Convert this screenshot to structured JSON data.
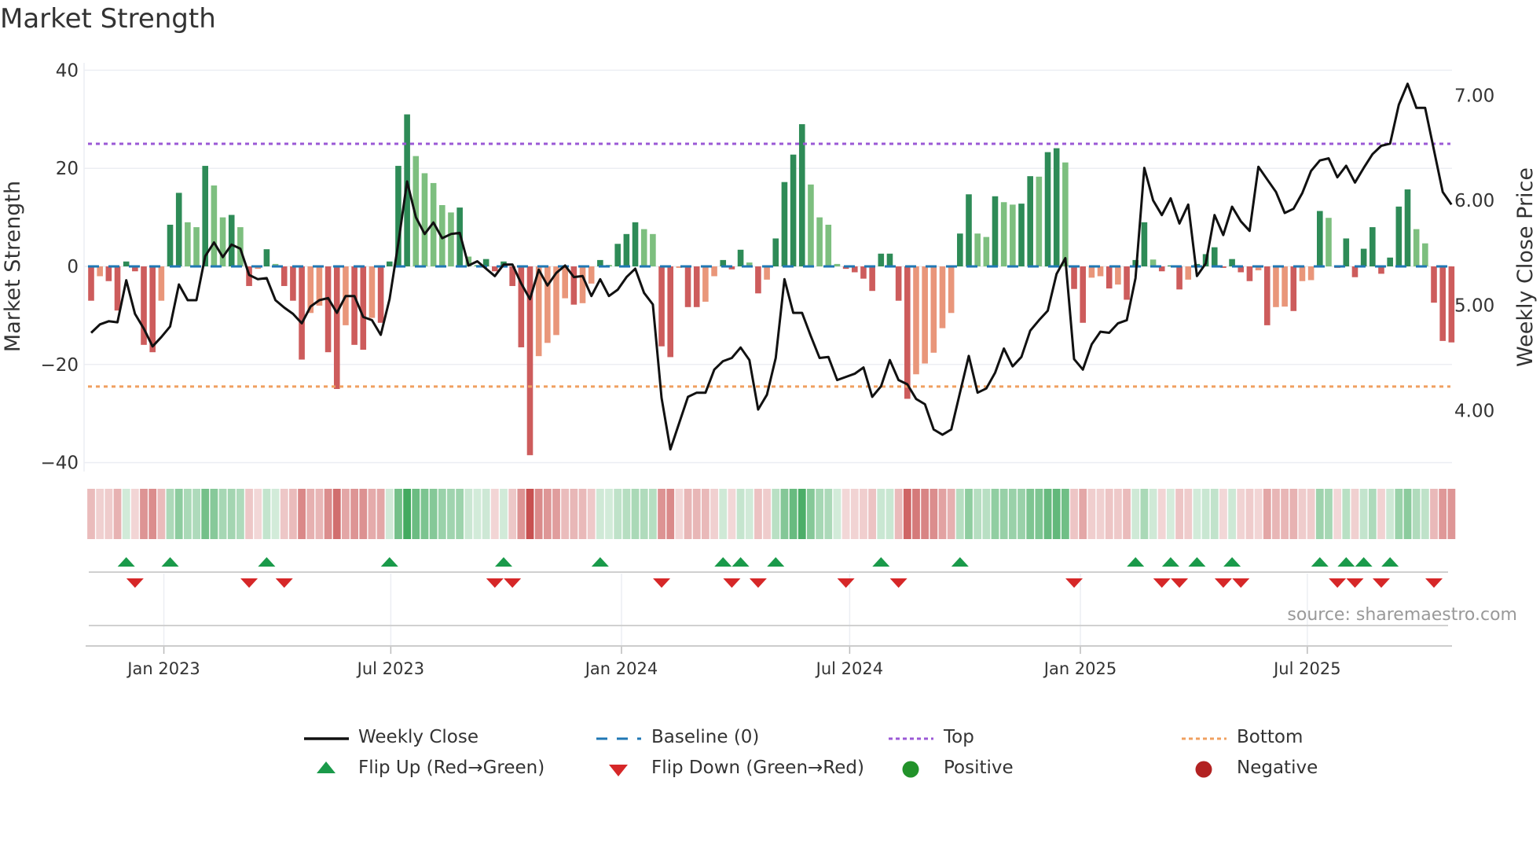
{
  "title": "Market Strength",
  "source": "source: sharemaestro.com",
  "chart_data": {
    "type": "bar",
    "title": "Market Strength",
    "ylabel": "Market Strength",
    "y2label": "Weekly Close Price",
    "ylim": [
      -40,
      40
    ],
    "y2lim": [
      3.5,
      7.3
    ],
    "yticks": [
      "40",
      "20",
      "0",
      "−20",
      "−40"
    ],
    "ytick_values": [
      40,
      20,
      0,
      -20,
      -40
    ],
    "y2ticks": [
      "7.00",
      "6.00",
      "5.00",
      "4.00"
    ],
    "y2tick_values": [
      7,
      6,
      5,
      4
    ],
    "frequency": "weekly",
    "first_week": "2022-11-04",
    "xticks": [
      {
        "label": "Jan 2023",
        "date": "2023-01-01"
      },
      {
        "label": "Jul 2023",
        "date": "2023-07-01"
      },
      {
        "label": "Jan 2024",
        "date": "2024-01-01"
      },
      {
        "label": "Jul 2024",
        "date": "2024-07-01"
      },
      {
        "label": "Jan 2025",
        "date": "2025-01-01"
      },
      {
        "label": "Jul 2025",
        "date": "2025-07-01"
      }
    ],
    "top_level": 25,
    "bottom_level": -24.5,
    "baseline": 0,
    "strength": [
      -7,
      -2,
      -3,
      -9,
      1,
      -1,
      -16,
      -17.5,
      -7,
      8.5,
      15,
      9,
      8,
      20.5,
      16.5,
      10,
      10.5,
      8,
      -4,
      -0.5,
      3.5,
      0.5,
      -4,
      -7,
      -19,
      -9.5,
      -8,
      -17.5,
      -25,
      -12,
      -16,
      -17,
      -10.5,
      -11.5,
      1,
      20.5,
      31,
      22.5,
      19,
      17,
      12.5,
      11,
      12,
      2,
      0.3,
      1.5,
      -1,
      1,
      -4,
      -16.5,
      -38.5,
      -18.3,
      -15.6,
      -14,
      -6.5,
      -7.8,
      -7.5,
      -3.5,
      1.3,
      0.3,
      4.6,
      6.6,
      9,
      7.6,
      6.6,
      -16.3,
      -18.5,
      -0.3,
      -8.3,
      -8.3,
      -7.2,
      -2,
      1.3,
      -0.6,
      3.4,
      0.8,
      -5.5,
      -2.7,
      5.7,
      17.2,
      22.8,
      29,
      16.7,
      10,
      8.5,
      0.5,
      -0.5,
      -1.2,
      -2.5,
      -5,
      2.6,
      2.6,
      -7,
      -27,
      -22,
      -19.8,
      -17.6,
      -12.6,
      -9.5,
      6.7,
      14.7,
      6.7,
      6,
      14.3,
      13.1,
      12.6,
      12.8,
      18.4,
      18.3,
      23.3,
      24.1,
      21.2,
      -4.6,
      -11.5,
      -2.3,
      -2,
      -4.5,
      -3.7,
      -6.8,
      1.3,
      9,
      1.4,
      -1,
      0.2,
      -4.7,
      -2.7,
      0.5,
      2.5,
      3.9,
      -0.3,
      1.5,
      -1.2,
      -3,
      -0.8,
      -12,
      -8.3,
      -8.2,
      -9.1,
      -3,
      -2.8,
      11.3,
      9.9,
      -0.3,
      5.7,
      -2.2,
      3.6,
      8,
      -1.5,
      1.8,
      12.2,
      15.7,
      7.6,
      4.7,
      -7.4,
      -15.2,
      -15.5
    ],
    "weekly_close": [
      4.74,
      4.82,
      4.85,
      4.84,
      5.24,
      4.92,
      4.78,
      4.61,
      4.7,
      4.8,
      5.2,
      5.05,
      5.05,
      5.47,
      5.6,
      5.46,
      5.58,
      5.54,
      5.29,
      5.25,
      5.26,
      5.05,
      4.98,
      4.92,
      4.83,
      4.99,
      5.05,
      5.07,
      4.93,
      5.09,
      5.09,
      4.89,
      4.86,
      4.72,
      5.06,
      5.59,
      6.18,
      5.84,
      5.68,
      5.79,
      5.64,
      5.68,
      5.69,
      5.38,
      5.42,
      5.35,
      5.28,
      5.39,
      5.39,
      5.21,
      5.06,
      5.34,
      5.19,
      5.31,
      5.38,
      5.27,
      5.28,
      5.09,
      5.25,
      5.09,
      5.15,
      5.27,
      5.35,
      5.12,
      5.01,
      4.12,
      3.63,
      3.88,
      4.13,
      4.17,
      4.17,
      4.39,
      4.47,
      4.5,
      4.6,
      4.48,
      4.01,
      4.15,
      4.5,
      5.25,
      4.93,
      4.93,
      4.71,
      4.5,
      4.51,
      4.29,
      4.32,
      4.35,
      4.41,
      4.13,
      4.23,
      4.48,
      4.29,
      4.25,
      4.11,
      4.06,
      3.82,
      3.77,
      3.82,
      4.17,
      4.52,
      4.17,
      4.21,
      4.36,
      4.59,
      4.42,
      4.51,
      4.76,
      4.86,
      4.95,
      5.3,
      5.45,
      4.49,
      4.39,
      4.63,
      4.75,
      4.74,
      4.83,
      4.86,
      5.26,
      6.31,
      6.0,
      5.86,
      6.02,
      5.78,
      5.96,
      5.28,
      5.4,
      5.86,
      5.67,
      5.94,
      5.8,
      5.71,
      6.32,
      6.2,
      6.08,
      5.88,
      5.92,
      6.07,
      6.28,
      6.38,
      6.4,
      6.22,
      6.33,
      6.17,
      6.31,
      6.44,
      6.52,
      6.54,
      6.91,
      7.11,
      6.88,
      6.88,
      6.48,
      6.08,
      5.96
    ],
    "flip_up_weeks": [
      4,
      9,
      20,
      34,
      47,
      58,
      72,
      74,
      78,
      90,
      99,
      119,
      123,
      126,
      130,
      140,
      143,
      145,
      148
    ],
    "flip_down_weeks": [
      5,
      18,
      22,
      46,
      48,
      65,
      73,
      76,
      86,
      92,
      112,
      122,
      124,
      129,
      131,
      142,
      144,
      147,
      153
    ],
    "legend": {
      "position": "bottom",
      "items": [
        {
          "label": "Weekly Close",
          "kind": "line"
        },
        {
          "label": "Baseline (0)",
          "kind": "dash"
        },
        {
          "label": "Top",
          "kind": "dot-top"
        },
        {
          "label": "Bottom",
          "kind": "dot-bottom"
        },
        {
          "label": "Flip Up (Red→Green)",
          "kind": "tri-up"
        },
        {
          "label": "Flip Down (Green→Red)",
          "kind": "tri-down"
        },
        {
          "label": "Positive",
          "kind": "dot-pos"
        },
        {
          "label": "Negative",
          "kind": "dot-neg"
        }
      ]
    },
    "colors": {
      "pos_strong": "#2e8b57",
      "pos_weak": "#7dbf7f",
      "neg_strong": "#cd5c5c",
      "neg_weak": "#e9967a",
      "close": "#111111",
      "baseline": "#1f77b4",
      "top": "#9b59d6",
      "bottom": "#f0a060",
      "flip_up": "#1a9a4a",
      "flip_down": "#d62728",
      "positive": "#22922a",
      "negative": "#b22222"
    }
  }
}
